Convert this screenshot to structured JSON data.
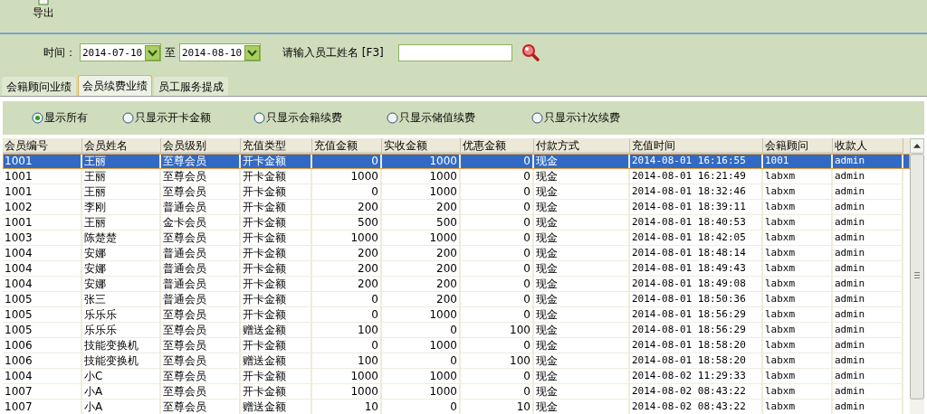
{
  "toolbar": {
    "export_label": "导出"
  },
  "filter": {
    "time_label": "时间：",
    "start_date": "2014-07-10",
    "to_label": "至",
    "end_date": "2014-08-10",
    "name_label": "请输入员工姓名 [F3]"
  },
  "tabs": [
    {
      "label": "会籍顾问业绩",
      "selected": false
    },
    {
      "label": "会员续费业绩",
      "selected": true
    },
    {
      "label": "员工服务提成",
      "selected": false
    }
  ],
  "filters": [
    {
      "label": "显示所有",
      "selected": true
    },
    {
      "label": "只显示开卡金额",
      "selected": false
    },
    {
      "label": "只显示会籍续费",
      "selected": false
    },
    {
      "label": "只显示储值续费",
      "selected": false
    },
    {
      "label": "只显示计次续费",
      "selected": false
    }
  ],
  "table": {
    "columns": [
      {
        "label": "会员编号",
        "kind": "text"
      },
      {
        "label": "会员姓名",
        "kind": "text"
      },
      {
        "label": "会员级别",
        "kind": "text"
      },
      {
        "label": "充值类型",
        "kind": "text"
      },
      {
        "label": "充值金额",
        "kind": "number"
      },
      {
        "label": "实收金额",
        "kind": "number"
      },
      {
        "label": "优惠金额",
        "kind": "number"
      },
      {
        "label": "付款方式",
        "kind": "text"
      },
      {
        "label": "充值时间",
        "kind": "mono"
      },
      {
        "label": "会籍顾问",
        "kind": "mono"
      },
      {
        "label": "收款人",
        "kind": "mono"
      }
    ],
    "rows": [
      {
        "selected": true,
        "cells": [
          "1001",
          "王丽",
          "至尊会员",
          "开卡金额",
          "0",
          "1000",
          "0",
          "现金",
          "2014-08-01 16:16:55",
          "1001",
          "admin"
        ]
      },
      {
        "selected": false,
        "cells": [
          "1001",
          "王丽",
          "至尊会员",
          "开卡金额",
          "1000",
          "1000",
          "0",
          "现金",
          "2014-08-01 16:21:49",
          "labxm",
          "admin"
        ]
      },
      {
        "selected": false,
        "cells": [
          "1001",
          "王丽",
          "至尊会员",
          "开卡金额",
          "0",
          "1000",
          "0",
          "现金",
          "2014-08-01 18:32:46",
          "labxm",
          "admin"
        ]
      },
      {
        "selected": false,
        "cells": [
          "1002",
          "李刚",
          "普通会员",
          "开卡金额",
          "200",
          "200",
          "0",
          "现金",
          "2014-08-01 18:39:11",
          "labxm",
          "admin"
        ]
      },
      {
        "selected": false,
        "cells": [
          "1001",
          "王丽",
          "金卡会员",
          "开卡金额",
          "500",
          "500",
          "0",
          "现金",
          "2014-08-01 18:40:53",
          "labxm",
          "admin"
        ]
      },
      {
        "selected": false,
        "cells": [
          "1003",
          "陈楚楚",
          "至尊会员",
          "开卡金额",
          "1000",
          "1000",
          "0",
          "现金",
          "2014-08-01 18:42:05",
          "labxm",
          "admin"
        ]
      },
      {
        "selected": false,
        "cells": [
          "1004",
          "安娜",
          "普通会员",
          "开卡金额",
          "200",
          "200",
          "0",
          "现金",
          "2014-08-01 18:48:14",
          "labxm",
          "admin"
        ]
      },
      {
        "selected": false,
        "cells": [
          "1004",
          "安娜",
          "普通会员",
          "开卡金额",
          "200",
          "200",
          "0",
          "现金",
          "2014-08-01 18:49:43",
          "labxm",
          "admin"
        ]
      },
      {
        "selected": false,
        "cells": [
          "1004",
          "安娜",
          "普通会员",
          "开卡金额",
          "200",
          "200",
          "0",
          "现金",
          "2014-08-01 18:49:08",
          "labxm",
          "admin"
        ]
      },
      {
        "selected": false,
        "cells": [
          "1005",
          "张三",
          "普通会员",
          "开卡金额",
          "0",
          "200",
          "0",
          "现金",
          "2014-08-01 18:50:36",
          "labxm",
          "admin"
        ]
      },
      {
        "selected": false,
        "cells": [
          "1005",
          "乐乐乐",
          "至尊会员",
          "开卡金额",
          "0",
          "1000",
          "0",
          "现金",
          "2014-08-01 18:56:29",
          "labxm",
          "admin"
        ]
      },
      {
        "selected": false,
        "cells": [
          "1005",
          "乐乐乐",
          "至尊会员",
          "赠送金额",
          "100",
          "0",
          "100",
          "现金",
          "2014-08-01 18:56:29",
          "labxm",
          "admin"
        ]
      },
      {
        "selected": false,
        "cells": [
          "1006",
          "技能变换机",
          "至尊会员",
          "开卡金额",
          "0",
          "1000",
          "0",
          "现金",
          "2014-08-01 18:58:20",
          "labxm",
          "admin"
        ]
      },
      {
        "selected": false,
        "cells": [
          "1006",
          "技能变换机",
          "至尊会员",
          "赠送金额",
          "100",
          "0",
          "100",
          "现金",
          "2014-08-01 18:58:20",
          "labxm",
          "admin"
        ]
      },
      {
        "selected": false,
        "cells": [
          "1004",
          "小C",
          "至尊会员",
          "开卡金额",
          "1000",
          "1000",
          "0",
          "现金",
          "2014-08-02 11:29:33",
          "labxm",
          "admin"
        ]
      },
      {
        "selected": false,
        "cells": [
          "1007",
          "小A",
          "至尊会员",
          "开卡金额",
          "1000",
          "1000",
          "0",
          "现金",
          "2014-08-02 08:43:22",
          "labxm",
          "admin"
        ]
      },
      {
        "selected": false,
        "cells": [
          "1007",
          "小A",
          "至尊会员",
          "赠送金额",
          "10",
          "0",
          "10",
          "现金",
          "2014-08-02 08:43:22",
          "labxm",
          "admin"
        ]
      }
    ]
  }
}
